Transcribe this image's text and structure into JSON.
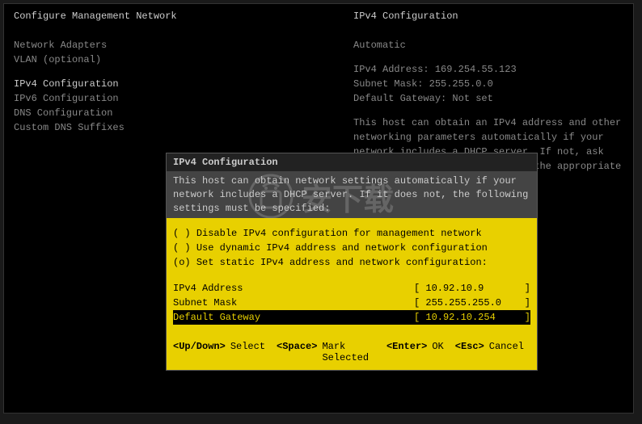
{
  "header": {
    "left_title": "Configure Management Network",
    "right_title": "IPv4 Configuration"
  },
  "left_menu": {
    "items": [
      "Network Adapters",
      "VLAN (optional)",
      "",
      "IPv4 Configuration",
      "IPv6 Configuration",
      "DNS Configuration",
      "Custom DNS Suffixes"
    ],
    "selected_index": 3
  },
  "right_info": {
    "mode": "Automatic",
    "ipv4_label": "IPv4 Address:",
    "ipv4_value": "169.254.55.123",
    "subnet_label": "Subnet Mask:",
    "subnet_value": "255.255.0.0",
    "gateway_label": "Default Gateway:",
    "gateway_value": "Not set",
    "help_text": "This host can obtain an IPv4 address and other networking parameters automatically if your network includes a DHCP server. If not, ask your network administrator for the appropriate settings."
  },
  "dialog": {
    "title": "IPv4 Configuration",
    "description": "This host can obtain network settings automatically if your network includes a DHCP server. If it does not, the following settings must be specified:",
    "options": [
      {
        "marker": "( )",
        "label": "Disable IPv4 configuration for management network"
      },
      {
        "marker": "( )",
        "label": "Use dynamic IPv4 address and network configuration"
      },
      {
        "marker": "(o)",
        "label": "Set static IPv4 address and network configuration:"
      }
    ],
    "fields": [
      {
        "label": "IPv4 Address",
        "value": "[ 10.92.10.9       ]",
        "highlight": false
      },
      {
        "label": "Subnet Mask",
        "value": "[ 255.255.255.0    ]",
        "highlight": false
      },
      {
        "label": "Default Gateway",
        "value": "[ 10.92.10.254     ]",
        "highlight": true
      }
    ],
    "footer": {
      "updown_key": "<Up/Down>",
      "updown_action": "Select",
      "space_key": "<Space>",
      "space_action": "Mark Selected",
      "enter_key": "<Enter>",
      "enter_action": "OK",
      "esc_key": "<Esc>",
      "esc_action": "Cancel"
    }
  },
  "watermark": {
    "text": "安下载"
  }
}
